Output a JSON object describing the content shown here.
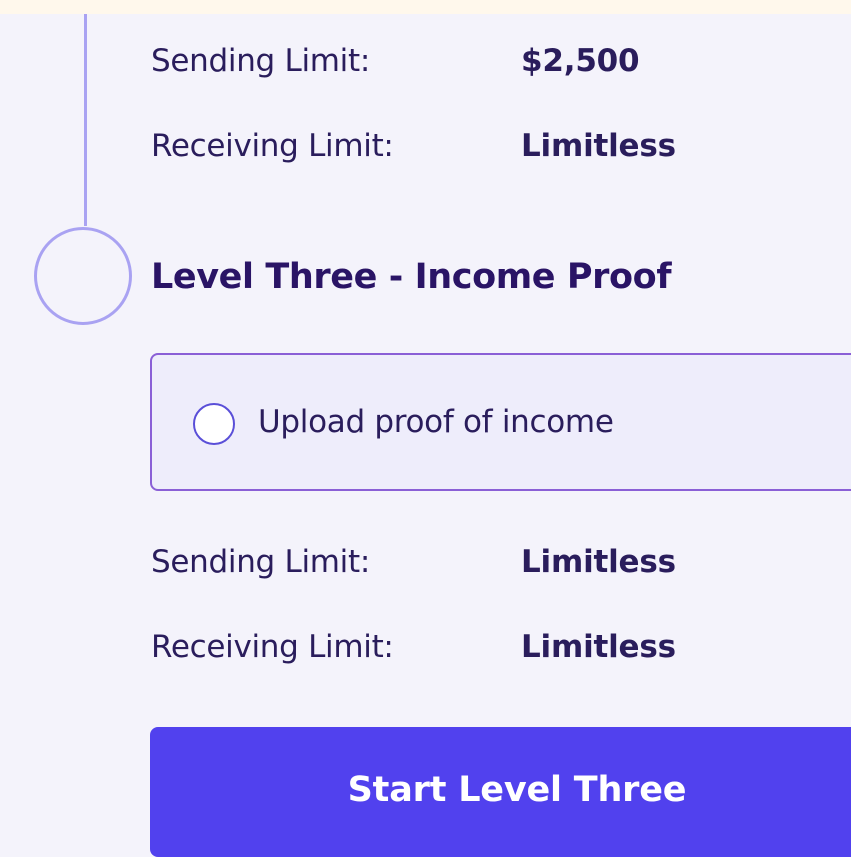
{
  "level_two": {
    "limits": [
      {
        "label": "Sending Limit:",
        "value": "$2,500"
      },
      {
        "label": "Receiving Limit:",
        "value": "Limitless"
      }
    ]
  },
  "level_three": {
    "title": "Level Three - Income Proof",
    "tasks": [
      {
        "label": "Upload proof of income",
        "checked": false
      }
    ],
    "limits": [
      {
        "label": "Sending Limit:",
        "value": "Limitless"
      },
      {
        "label": "Receiving Limit:",
        "value": "Limitless"
      }
    ],
    "start_button_label": "Start Level Three"
  },
  "colors": {
    "accent": "#5141ee",
    "timeline": "#a9a2f2",
    "task_border": "#8a5fd6",
    "heading": "#2a1466",
    "text": "#2a1d5c",
    "background": "#f4f3fb"
  }
}
